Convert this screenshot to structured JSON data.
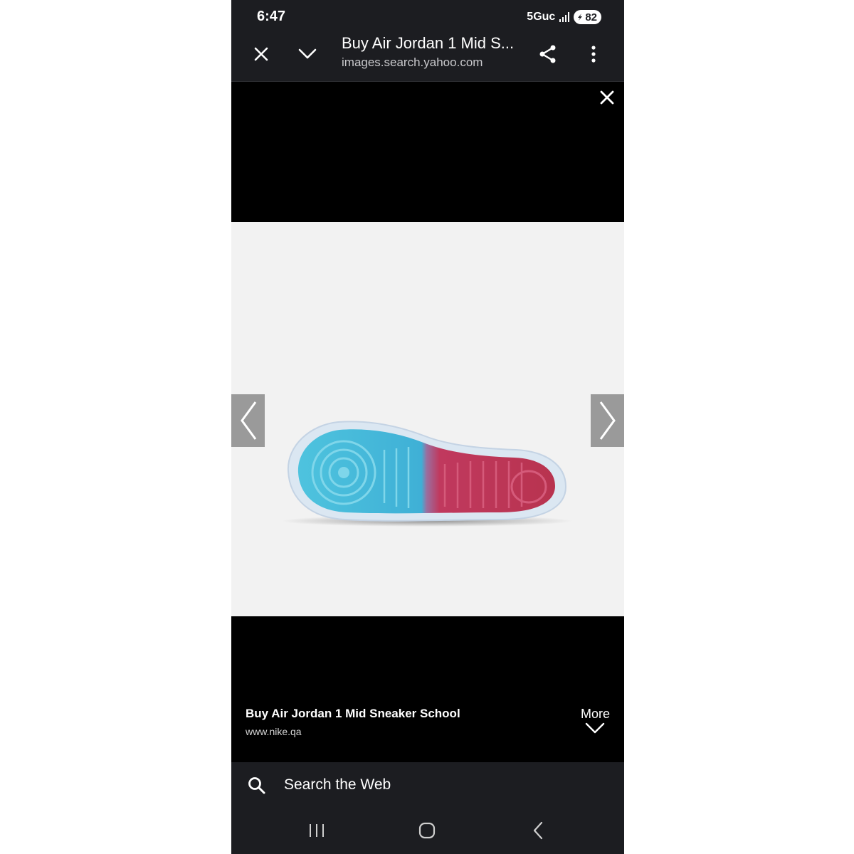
{
  "status_bar": {
    "time": "6:47",
    "network": "5Guc",
    "battery": "82"
  },
  "browser_header": {
    "title": "Buy Air Jordan 1 Mid S...",
    "url": "images.search.yahoo.com",
    "icons": [
      "close-icon",
      "chevron-down-icon",
      "share-icon",
      "more-vertical-icon"
    ]
  },
  "image_viewer": {
    "image": "sneaker-sole",
    "caption_title": "Buy Air Jordan 1 Mid Sneaker School",
    "caption_source": "www.nike.qa",
    "more_label": "More"
  },
  "search_bar": {
    "label": "Search the Web"
  },
  "colors": {
    "header_bg": "#1c1d21",
    "viewer_bg": "#000000",
    "sole_blue": "#4ec3de",
    "sole_red": "#c0395e"
  }
}
